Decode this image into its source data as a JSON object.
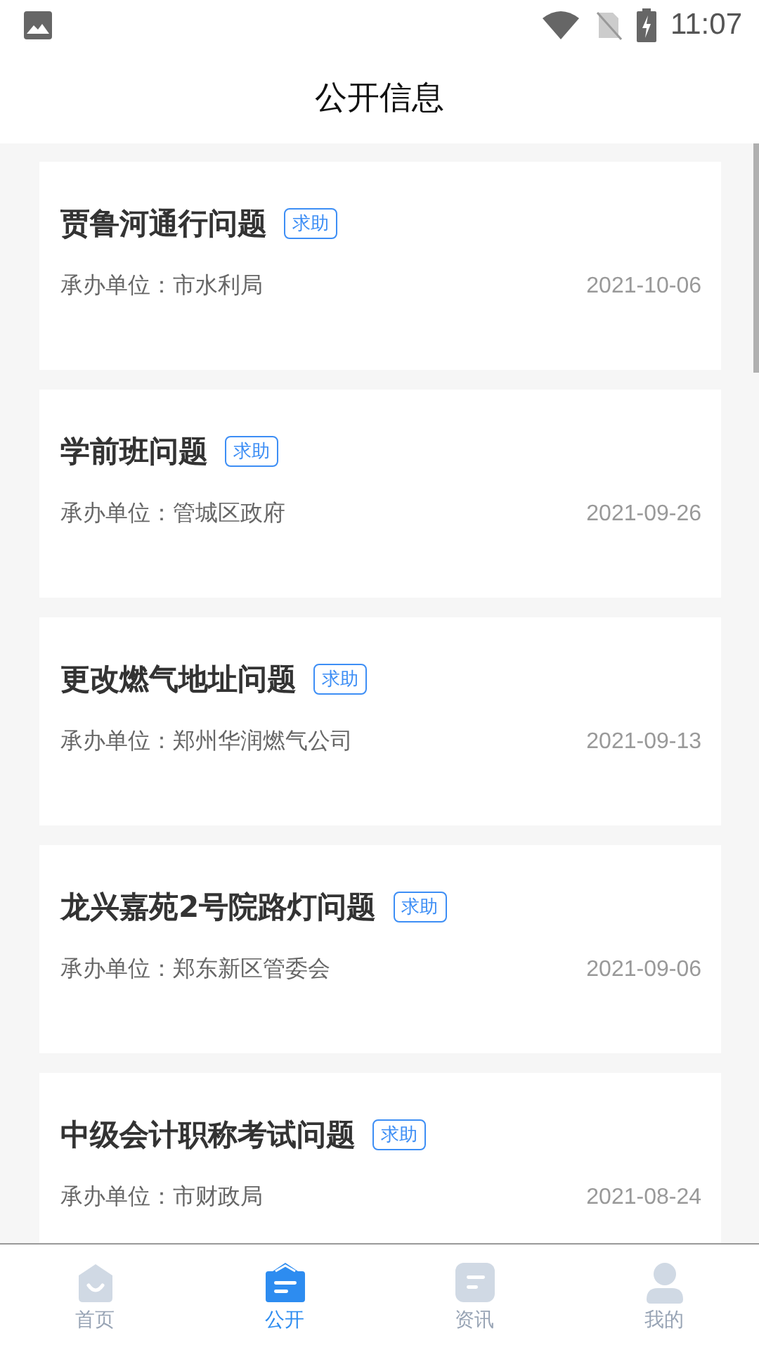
{
  "status_bar": {
    "time": "11:07"
  },
  "header": {
    "title": "公开信息"
  },
  "items": [
    {
      "title": "贾鲁河通行问题",
      "tag": "求助",
      "unit": "承办单位：市水利局",
      "date": "2021-10-06"
    },
    {
      "title": "学前班问题",
      "tag": "求助",
      "unit": "承办单位：管城区政府",
      "date": "2021-09-26"
    },
    {
      "title": "更改燃气地址问题",
      "tag": "求助",
      "unit": "承办单位：郑州华润燃气公司",
      "date": "2021-09-13"
    },
    {
      "title": "龙兴嘉苑2号院路灯问题",
      "tag": "求助",
      "unit": "承办单位：郑东新区管委会",
      "date": "2021-09-06"
    },
    {
      "title": "中级会计职称考试问题",
      "tag": "求助",
      "unit": "承办单位：市财政局",
      "date": "2021-08-24"
    }
  ],
  "tabs": [
    {
      "kind": "home",
      "label": "首页",
      "selected": false
    },
    {
      "kind": "public",
      "label": "公开",
      "selected": true
    },
    {
      "kind": "news",
      "label": "资讯",
      "selected": false
    },
    {
      "kind": "profile",
      "label": "我的",
      "selected": false
    }
  ]
}
